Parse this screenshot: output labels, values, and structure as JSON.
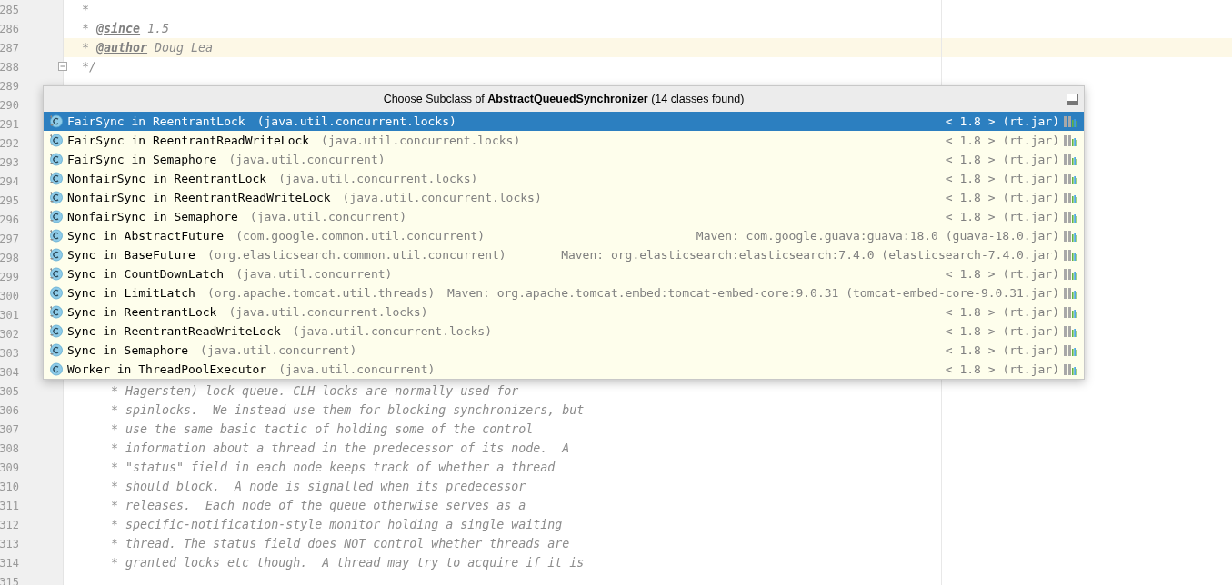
{
  "editor": {
    "lines": [
      {
        "number": "285",
        "current": false,
        "segments": [
          {
            "kind": "comment",
            "text": " *"
          }
        ]
      },
      {
        "number": "286",
        "current": false,
        "segments": [
          {
            "kind": "comment",
            "text": " * "
          },
          {
            "kind": "tag",
            "text": "@since"
          },
          {
            "kind": "comment",
            "text": " 1.5"
          }
        ]
      },
      {
        "number": "287",
        "current": true,
        "segments": [
          {
            "kind": "comment",
            "text": " * "
          },
          {
            "kind": "tag",
            "text": "@author"
          },
          {
            "kind": "comment",
            "text": " Doug Lea"
          }
        ]
      },
      {
        "number": "288",
        "current": false,
        "folded": false,
        "segments": [
          {
            "kind": "comment",
            "text": " */"
          }
        ]
      },
      {
        "number": "289",
        "current": false
      },
      {
        "number": "290",
        "current": false
      },
      {
        "number": "291",
        "current": false
      },
      {
        "number": "292",
        "current": false
      },
      {
        "number": "293",
        "current": false
      },
      {
        "number": "294",
        "current": false
      },
      {
        "number": "295",
        "current": false
      },
      {
        "number": "296",
        "current": false
      },
      {
        "number": "297",
        "current": false
      },
      {
        "number": "298",
        "current": false
      },
      {
        "number": "299",
        "current": false
      },
      {
        "number": "300",
        "current": false
      },
      {
        "number": "301",
        "current": false
      },
      {
        "number": "302",
        "current": false
      },
      {
        "number": "303",
        "current": false
      },
      {
        "number": "304",
        "current": false
      },
      {
        "number": "305",
        "current": false,
        "segments": [
          {
            "kind": "comment",
            "text": "     * Hagersten) lock queue. CLH locks are normally used for"
          }
        ]
      },
      {
        "number": "306",
        "current": false,
        "segments": [
          {
            "kind": "comment",
            "text": "     * spinlocks.  We instead use them for blocking synchronizers, but"
          }
        ]
      },
      {
        "number": "307",
        "current": false,
        "segments": [
          {
            "kind": "comment",
            "text": "     * use the same basic tactic of holding some of the control"
          }
        ]
      },
      {
        "number": "308",
        "current": false,
        "segments": [
          {
            "kind": "comment",
            "text": "     * information about a thread in the predecessor of its node.  A"
          }
        ]
      },
      {
        "number": "309",
        "current": false,
        "segments": [
          {
            "kind": "comment",
            "text": "     * \"status\" field in each node keeps track of whether a thread"
          }
        ]
      },
      {
        "number": "310",
        "current": false,
        "segments": [
          {
            "kind": "comment",
            "text": "     * should block.  A node is signalled when its predecessor"
          }
        ]
      },
      {
        "number": "311",
        "current": false,
        "segments": [
          {
            "kind": "comment",
            "text": "     * releases.  Each node of the queue otherwise serves as a"
          }
        ]
      },
      {
        "number": "312",
        "current": false,
        "segments": [
          {
            "kind": "comment",
            "text": "     * specific-notification-style monitor holding a single waiting"
          }
        ]
      },
      {
        "number": "313",
        "current": false,
        "segments": [
          {
            "kind": "comment",
            "text": "     * thread. The status field does NOT control whether threads are"
          }
        ]
      },
      {
        "number": "314",
        "current": false,
        "segments": [
          {
            "kind": "comment",
            "text": "     * granted locks etc though.  A thread may try to acquire if it is"
          }
        ]
      },
      {
        "number": "315",
        "current": false
      }
    ]
  },
  "popup": {
    "title": "Choose Subclass of **AbstractQueuedSynchronizer** (14 classes found)",
    "rows": [
      {
        "name": "FairSync in ReentrantLock",
        "package": "(java.util.concurrent.locks)",
        "location": "< 1.8 > (rt.jar)",
        "inner": true,
        "selected": true
      },
      {
        "name": "FairSync in ReentrantReadWriteLock",
        "package": "(java.util.concurrent.locks)",
        "location": "< 1.8 > (rt.jar)",
        "inner": true,
        "selected": false
      },
      {
        "name": "FairSync in Semaphore",
        "package": "(java.util.concurrent)",
        "location": "< 1.8 > (rt.jar)",
        "inner": true,
        "selected": false
      },
      {
        "name": "NonfairSync in ReentrantLock",
        "package": "(java.util.concurrent.locks)",
        "location": "< 1.8 > (rt.jar)",
        "inner": true,
        "selected": false
      },
      {
        "name": "NonfairSync in ReentrantReadWriteLock",
        "package": "(java.util.concurrent.locks)",
        "location": "< 1.8 > (rt.jar)",
        "inner": true,
        "selected": false
      },
      {
        "name": "NonfairSync in Semaphore",
        "package": "(java.util.concurrent)",
        "location": "< 1.8 > (rt.jar)",
        "inner": true,
        "selected": false
      },
      {
        "name": "Sync in AbstractFuture",
        "package": "(com.google.common.util.concurrent)",
        "location": "Maven: com.google.guava:guava:18.0 (guava-18.0.jar)",
        "inner": true,
        "selected": false
      },
      {
        "name": "Sync in BaseFuture",
        "package": "(org.elasticsearch.common.util.concurrent)",
        "location": "Maven: org.elasticsearch:elasticsearch:7.4.0 (elasticsearch-7.4.0.jar)",
        "inner": true,
        "selected": false
      },
      {
        "name": "Sync in CountDownLatch",
        "package": "(java.util.concurrent)",
        "location": "< 1.8 > (rt.jar)",
        "inner": true,
        "selected": false
      },
      {
        "name": "Sync in LimitLatch",
        "package": "(org.apache.tomcat.util.threads)",
        "location": "Maven: org.apache.tomcat.embed:tomcat-embed-core:9.0.31 (tomcat-embed-core-9.0.31.jar)",
        "inner": false,
        "selected": false
      },
      {
        "name": "Sync in ReentrantLock",
        "package": "(java.util.concurrent.locks)",
        "location": "< 1.8 > (rt.jar)",
        "inner": true,
        "selected": false
      },
      {
        "name": "Sync in ReentrantReadWriteLock",
        "package": "(java.util.concurrent.locks)",
        "location": "< 1.8 > (rt.jar)",
        "inner": true,
        "selected": false
      },
      {
        "name": "Sync in Semaphore",
        "package": "(java.util.concurrent)",
        "location": "< 1.8 > (rt.jar)",
        "inner": true,
        "selected": false
      },
      {
        "name": "Worker in ThreadPoolExecutor",
        "package": "(java.util.concurrent)",
        "location": "< 1.8 > (rt.jar)",
        "inner": false,
        "selected": false
      }
    ]
  }
}
